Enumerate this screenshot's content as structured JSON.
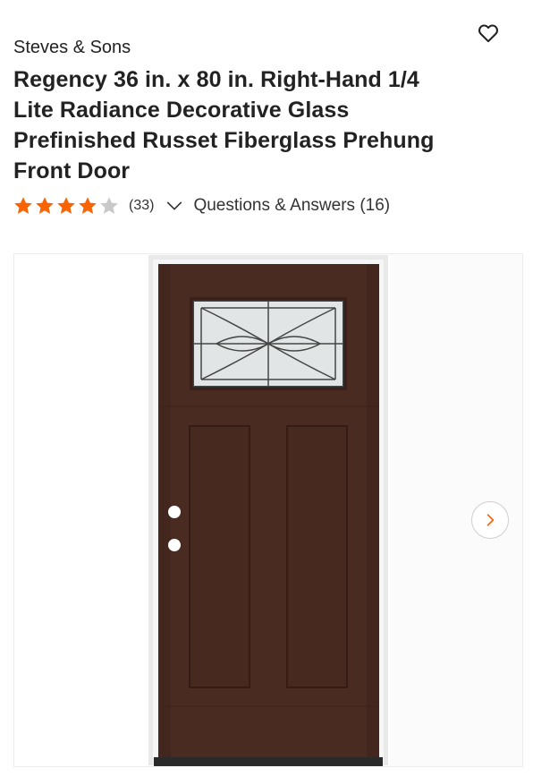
{
  "product": {
    "brand": "Steves & Sons",
    "title": "Regency 36 in. x 80 in. Right-Hand 1/4 Lite Radiance Decorative Glass Prefinished Russet Fiberglass Prehung Front Door"
  },
  "rating": {
    "stars": 4,
    "max_stars": 5,
    "review_count": "(33)",
    "qa_label": "Questions & Answers (16)"
  },
  "icons": {
    "favorite": "heart-outline-icon",
    "star": "star-icon",
    "expand": "chevron-down-icon",
    "next": "chevron-right-icon"
  },
  "colors": {
    "accent": "#f96302",
    "star_empty": "#c9c9c9",
    "door": "#4a2b22"
  }
}
